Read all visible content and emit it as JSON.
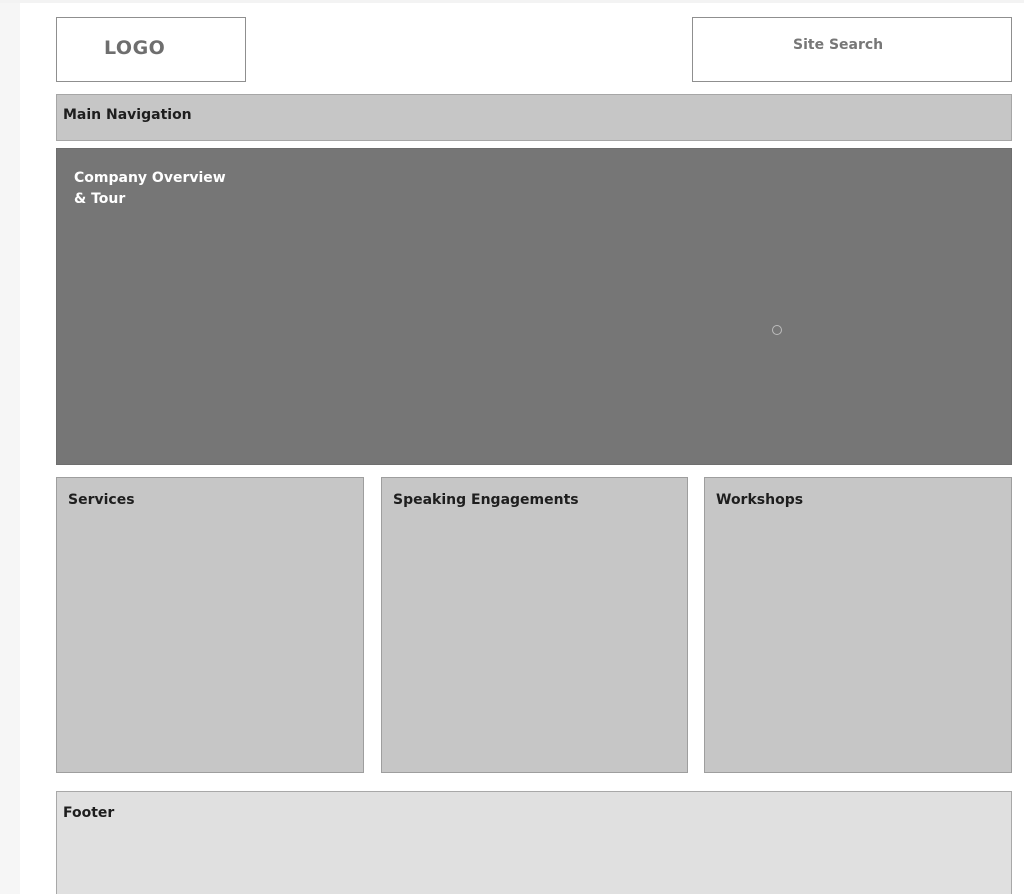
{
  "header": {
    "logo_label": "LOGO",
    "search_label": "Site Search"
  },
  "nav": {
    "label": "Main Navigation"
  },
  "hero": {
    "title_line1": "Company Overview",
    "title_line2": "& Tour"
  },
  "sections": [
    {
      "title": "Services"
    },
    {
      "title": "Speaking Engagements"
    },
    {
      "title": "Workshops"
    }
  ],
  "footer": {
    "label": "Footer"
  },
  "colors": {
    "panel_gray": "#c6c6c6",
    "hero_gray": "#767676",
    "footer_gray": "#e0e0e0"
  }
}
